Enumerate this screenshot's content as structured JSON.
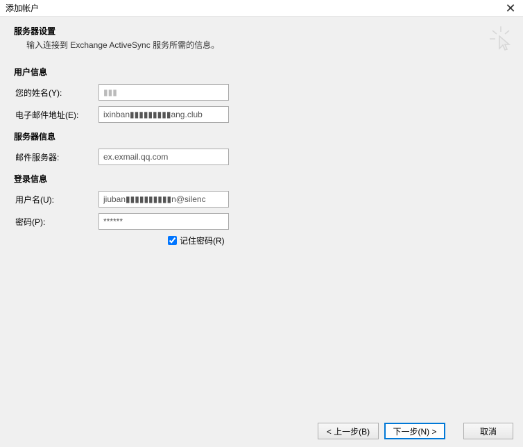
{
  "window": {
    "title": "添加帐户"
  },
  "header": {
    "title": "服务器设置",
    "description": "输入连接到 Exchange ActiveSync 服务所需的信息。"
  },
  "sections": {
    "userInfo": {
      "heading": "用户信息",
      "name": {
        "label": "您的姓名(Y):",
        "value": "▮▮▮"
      },
      "email": {
        "label": "电子邮件地址(E):",
        "value": "ixinban▮▮▮▮▮▮▮▮▮ang.club"
      }
    },
    "serverInfo": {
      "heading": "服务器信息",
      "mailServer": {
        "label": "邮件服务器:",
        "value": "ex.exmail.qq.com"
      }
    },
    "loginInfo": {
      "heading": "登录信息",
      "username": {
        "label": "用户名(U):",
        "value": "jiuban▮▮▮▮▮▮▮▮▮▮n@silenc"
      },
      "password": {
        "label": "密码(P):",
        "value": "******"
      },
      "remember": {
        "label": "记住密码(R)",
        "checked": true
      }
    }
  },
  "buttons": {
    "back": "< 上一步(B)",
    "next": "下一步(N) >",
    "cancel": "取消"
  }
}
